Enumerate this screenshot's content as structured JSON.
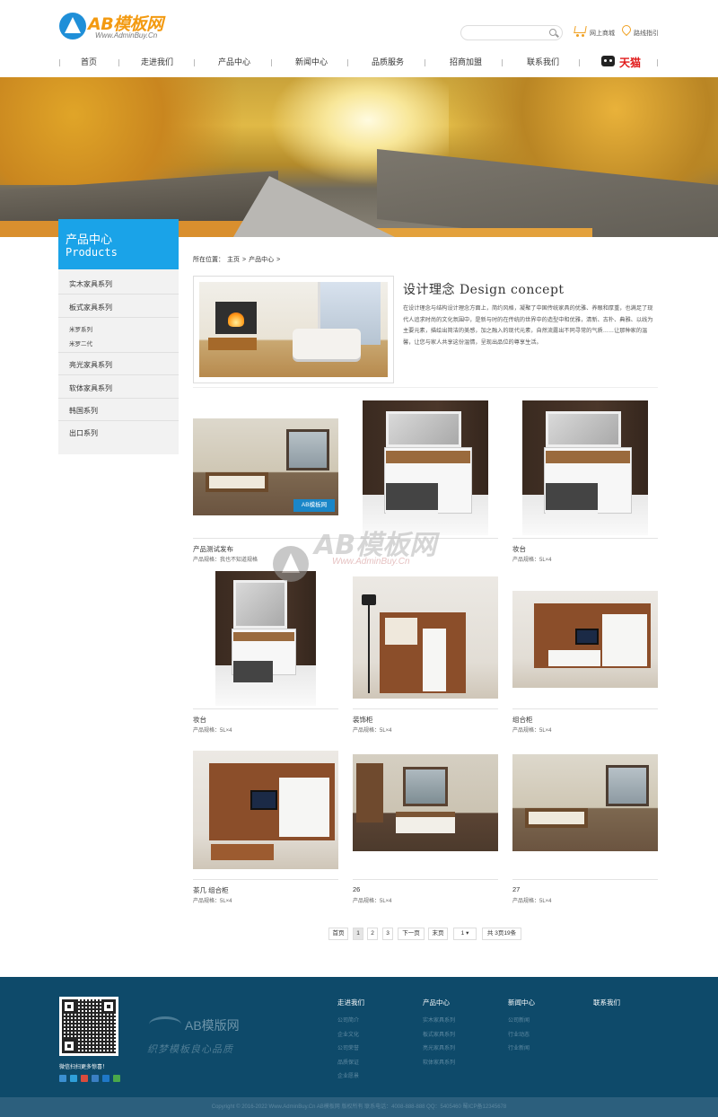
{
  "header": {
    "logo_text": "AB模板网",
    "logo_sub": "Www.AdminBuy.Cn",
    "search_placeholder": "",
    "links": [
      "网上商城",
      "路线指引"
    ]
  },
  "nav": {
    "items": [
      "首页",
      "走进我们",
      "产品中心",
      "新闻中心",
      "品质服务",
      "招商加盟",
      "联系我们"
    ],
    "tmall": "天猫"
  },
  "sidebar": {
    "title": "产品中心",
    "title_en": "Products",
    "items": [
      {
        "label": "实木家具系列",
        "sub": false
      },
      {
        "label": "板式家具系列",
        "sub": false
      },
      {
        "label": "米罗系列",
        "sub": true
      },
      {
        "label": "米罗二代",
        "sub": true
      },
      {
        "label": "亮光家具系列",
        "sub": false
      },
      {
        "label": "软体家具系列",
        "sub": false
      },
      {
        "label": "韩国系列",
        "sub": false
      },
      {
        "label": "出口系列",
        "sub": false
      }
    ]
  },
  "breadcrumb": {
    "label": "所在位置：",
    "items": [
      "主页",
      "产品中心"
    ]
  },
  "intro": {
    "title": "设计理念 Design concept",
    "text": "在设计理念与结构设计理念方面上，简约风格，凝聚了中国传统家具的优雅、养眼和厚重，也满足了现代人追求时尚的文化氛围中，是新与时的在传统的世界中的造型中和优雅，清新、古朴、典雅、以线为主要元素，描绘出简洁的美感，加之融入的现代元素，自然流露出不同寻常的气质……让那种家的温馨，让您与家人共享这份温情，呈现出品位的尊享生活。"
  },
  "products": [
    {
      "name": "产品测试发布",
      "spec": "产品规格：我也不知道规格"
    },
    {
      "name": "",
      "spec": ""
    },
    {
      "name": "妆台",
      "spec": "产品规格：5L×4"
    },
    {
      "name": "妆台",
      "spec": "产品规格：5L×4"
    },
    {
      "name": "装饰柜",
      "spec": "产品规格：5L×4"
    },
    {
      "name": "组合柜",
      "spec": "产品规格：5L×4"
    },
    {
      "name": "茶几 组合柜",
      "spec": "产品规格：5L×4"
    },
    {
      "name": "26",
      "spec": "产品规格：5L×4"
    },
    {
      "name": "27",
      "spec": "产品规格：5L×4"
    }
  ],
  "product_badge": "AB模板网",
  "pager": {
    "first": "首页",
    "pages": [
      "1",
      "2",
      "3"
    ],
    "next": "下一页",
    "last": "末页",
    "select": "1",
    "total": "共 3页19条"
  },
  "watermark": {
    "title": "AB模板网",
    "sub": "Www.AdminBuy.Cn"
  },
  "footer": {
    "qr_caption": "微信扫扫更多惊喜！",
    "logo": "AB模版网",
    "slogan": "织梦模板良心品质",
    "columns": [
      {
        "title": "走进我们",
        "links": [
          "公司简介",
          "企业文化",
          "公司荣誉",
          "品质保证",
          "企业愿景"
        ]
      },
      {
        "title": "产品中心",
        "links": [
          "实木家具系列",
          "板式家具系列",
          "亮光家具系列",
          "软体家具系列"
        ]
      },
      {
        "title": "新闻中心",
        "links": [
          "公司新闻",
          "行业动态",
          "行业新闻"
        ]
      },
      {
        "title": "联系我们",
        "links": []
      }
    ],
    "copyright": "Copyright © 2016-2022 Www.AdminBuy.Cn AB模板网 版权所有    联系电话：4008-888-888    QQ：5405460    蜀ICP备12345678"
  },
  "colors": {
    "accent_blue": "#1aa3e8",
    "footer_bg": "#0e4a6a",
    "tmall_red": "#e01818",
    "logo_orange": "#f39a11"
  }
}
